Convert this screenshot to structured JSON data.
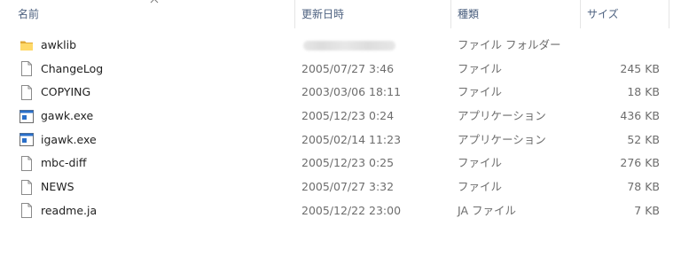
{
  "header": {
    "name": "名前",
    "date": "更新日時",
    "type": "種類",
    "size": "サイズ"
  },
  "files": [
    {
      "name": "awklib",
      "date": "",
      "type": "ファイル フォルダー",
      "size": "",
      "icon": "folder-icon"
    },
    {
      "name": "ChangeLog",
      "date": "2005/07/27 3:46",
      "type": "ファイル",
      "size": "245 KB",
      "icon": "document-icon"
    },
    {
      "name": "COPYING",
      "date": "2003/03/06 18:11",
      "type": "ファイル",
      "size": "18 KB",
      "icon": "document-icon"
    },
    {
      "name": "gawk.exe",
      "date": "2005/12/23 0:24",
      "type": "アプリケーション",
      "size": "436 KB",
      "icon": "application-icon"
    },
    {
      "name": "igawk.exe",
      "date": "2005/02/14 11:23",
      "type": "アプリケーション",
      "size": "52 KB",
      "icon": "application-icon"
    },
    {
      "name": "mbc-diff",
      "date": "2005/12/23 0:25",
      "type": "ファイル",
      "size": "276 KB",
      "icon": "document-icon"
    },
    {
      "name": "NEWS",
      "date": "2005/07/27 3:32",
      "type": "ファイル",
      "size": "78 KB",
      "icon": "document-icon"
    },
    {
      "name": "readme.ja",
      "date": "2005/12/22 23:00",
      "type": "JA ファイル",
      "size": "7 KB",
      "icon": "document-icon"
    }
  ],
  "colors": {
    "header_text": "#4c607f",
    "secondary_text": "#6d6d6d",
    "folder": "#f2c14e",
    "app_accent": "#2a6fc9"
  }
}
